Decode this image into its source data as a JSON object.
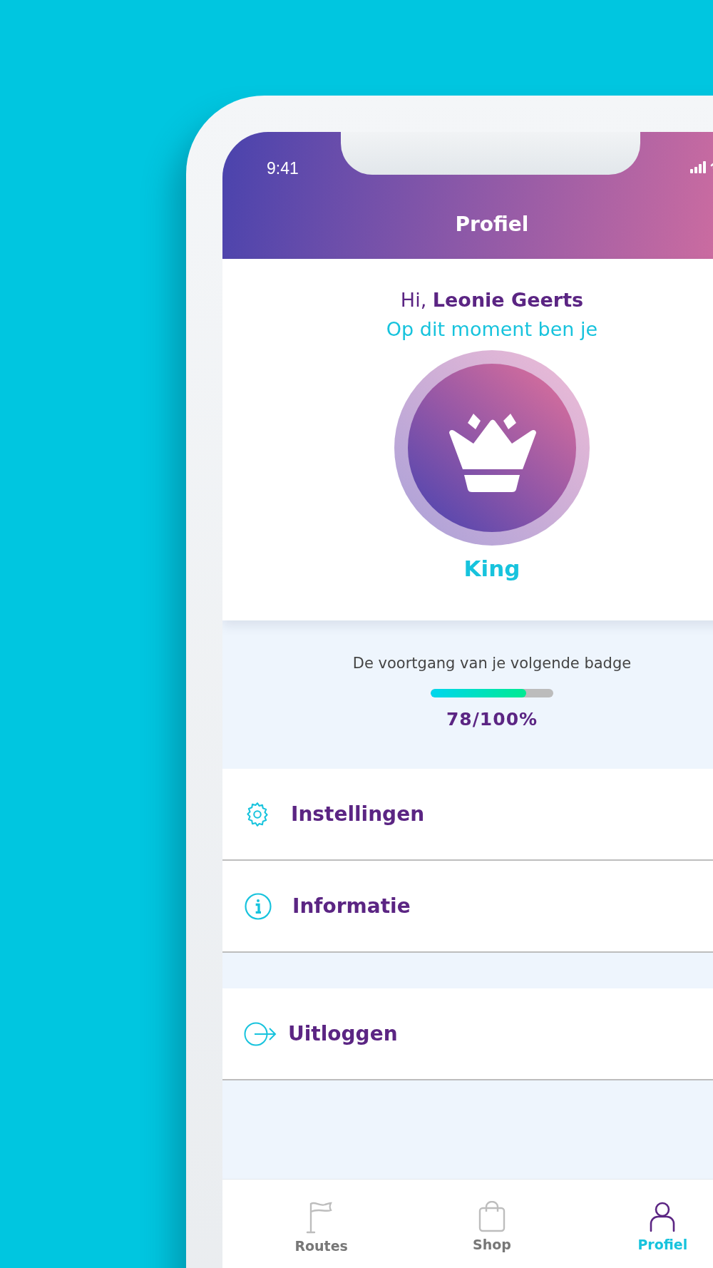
{
  "status_bar": {
    "time": "9:41"
  },
  "header": {
    "title": "Profiel"
  },
  "profile": {
    "greeting": "Hi, **Leonie Geerts**",
    "subtitle": "Op dit moment ben je",
    "badge": "King"
  },
  "progress": {
    "label": "De voortgang van je volgende badge",
    "level": 0.78,
    "reading": "78/100%"
  },
  "menu": [
    {
      "label": "Instellingen",
      "kind": "settings"
    },
    {
      "label": "Informatie",
      "kind": "info"
    }
  ],
  "account_menu": [
    {
      "label": "Uitloggen",
      "kind": "logout"
    }
  ],
  "tabs": [
    {
      "label": "Routes",
      "kind": "flag",
      "selected": false
    },
    {
      "label": "Shop",
      "kind": "bag",
      "selected": false
    },
    {
      "label": "Profiel",
      "kind": "person",
      "selected": true
    }
  ]
}
